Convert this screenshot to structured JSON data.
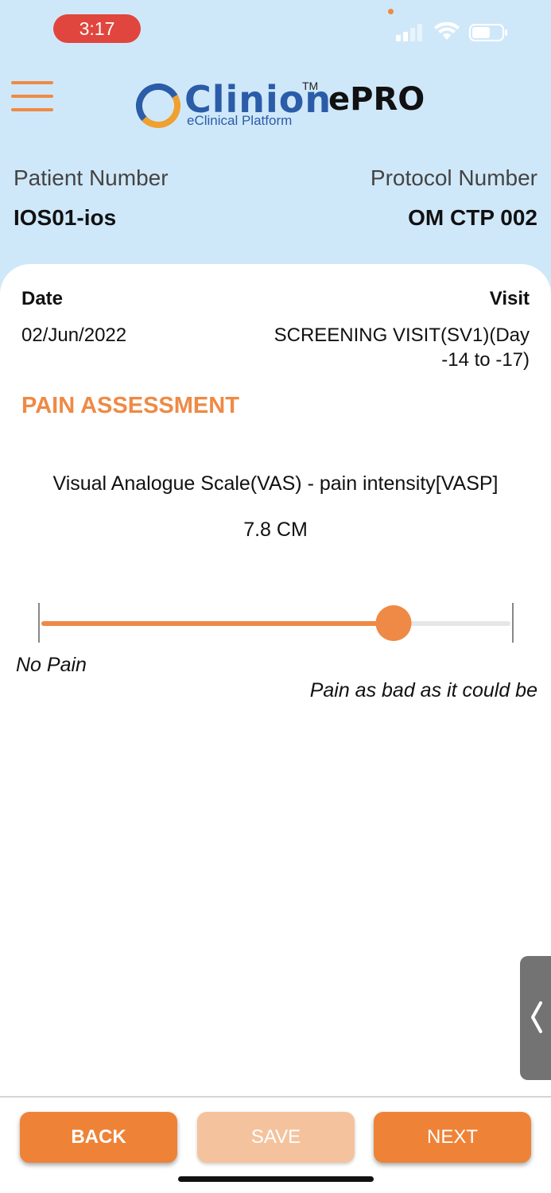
{
  "status_bar": {
    "time": "3:17",
    "time_pill_color": "#e0463d"
  },
  "header": {
    "logo_brand": "Clinion",
    "logo_tm": "TM",
    "logo_tagline": "eClinical Platform",
    "logo_product": "ePRO",
    "menu_icon": "hamburger-menu-icon"
  },
  "patient": {
    "patient_label": "Patient Number",
    "patient_value": "IOS01-ios",
    "protocol_label": "Protocol Number",
    "protocol_value": "OM CTP 002"
  },
  "visit_info": {
    "date_label": "Date",
    "date_value": "02/Jun/2022",
    "visit_label": "Visit",
    "visit_value": "SCREENING VISIT(SV1)(Day -14 to -17)"
  },
  "assessment": {
    "section_title": "PAIN ASSESSMENT",
    "question": "Visual Analogue Scale(VAS) - pain intensity[VASP]",
    "value_display": "7.8 CM",
    "slider_fraction": 0.75,
    "min_label": "No Pain",
    "max_label": "Pain as bad as it could be"
  },
  "footer": {
    "back_label": "BACK",
    "save_label": "SAVE",
    "next_label": "NEXT"
  },
  "colors": {
    "accent": "#ee8a45",
    "header_bg": "#cfe8f9",
    "save_disabled": "#f4c39d"
  }
}
